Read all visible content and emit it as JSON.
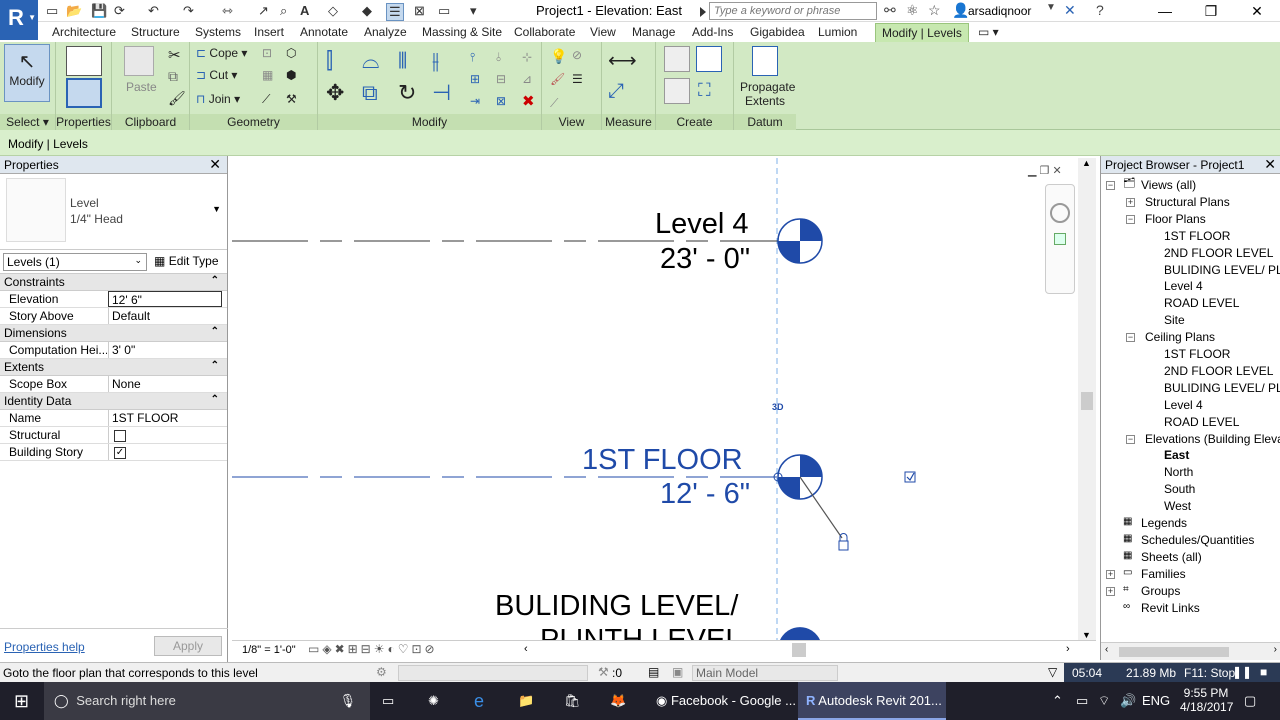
{
  "app": {
    "title": "Project1 - Elevation: East",
    "search_placeholder": "Type a keyword or phrase",
    "user": "arsadiqnoor"
  },
  "tabs": [
    "Architecture",
    "Structure",
    "Systems",
    "Insert",
    "Annotate",
    "Analyze",
    "Massing & Site",
    "Collaborate",
    "View",
    "Manage",
    "Add-Ins",
    "Gigabidea",
    "Lumion",
    "Modify | Levels"
  ],
  "ribbon": {
    "select": {
      "label": "Select",
      "modify": "Modify"
    },
    "properties_label": "Properties",
    "clipboard": {
      "label": "Clipboard",
      "paste": "Paste"
    },
    "geometry": {
      "label": "Geometry",
      "cope": "Cope",
      "cut": "Cut",
      "join": "Join"
    },
    "modify_label": "Modify",
    "view_label": "View",
    "measure_label": "Measure",
    "create_label": "Create",
    "datum": {
      "label": "Datum",
      "propagate": "Propagate",
      "extents": "Extents"
    }
  },
  "context_bar": "Modify | Levels",
  "properties": {
    "title": "Properties",
    "type_name": "Level",
    "type_sub": "1/4\" Head",
    "selector": "Levels (1)",
    "edit_type": "Edit Type",
    "sections": [
      {
        "name": "Constraints",
        "rows": [
          {
            "k": "Elevation",
            "v": "12'  6\""
          },
          {
            "k": "Story Above",
            "v": "Default"
          }
        ]
      },
      {
        "name": "Dimensions",
        "rows": [
          {
            "k": "Computation Hei...",
            "v": "3'  0\""
          }
        ]
      },
      {
        "name": "Extents",
        "rows": [
          {
            "k": "Scope Box",
            "v": "None"
          }
        ]
      },
      {
        "name": "Identity Data",
        "rows": [
          {
            "k": "Name",
            "v": "1ST FLOOR"
          },
          {
            "k": "Structural",
            "v": ""
          },
          {
            "k": "Building Story",
            "v": "✓"
          }
        ]
      }
    ],
    "help": "Properties help",
    "apply": "Apply"
  },
  "canvas": {
    "level4_name": "Level 4",
    "level4_elev": "23' - 0\"",
    "first_name": "1ST FLOOR",
    "first_elev": "12' - 6\"",
    "building_name": "BULIDING LEVEL/",
    "building_name2": "PLINTH LEVEL",
    "marker_3d": "3D",
    "scale": "1/8\" = 1'-0\""
  },
  "browser": {
    "title": "Project Browser - Project1",
    "nodes": [
      "Views (all)",
      "Structural Plans",
      "Floor Plans",
      "1ST FLOOR",
      "2ND FLOOR LEVEL",
      "BULIDING LEVEL/ PLINTH",
      "Level 4",
      "ROAD LEVEL",
      "Site",
      "Ceiling Plans",
      "1ST FLOOR",
      "2ND FLOOR LEVEL",
      "BULIDING LEVEL/ PLINTH",
      "Level 4",
      "ROAD LEVEL",
      "Elevations (Building Elevation)",
      "East",
      "North",
      "South",
      "West",
      "Legends",
      "Schedules/Quantities",
      "Sheets (all)",
      "Families",
      "Groups",
      "Revit Links"
    ]
  },
  "status": {
    "hint": "Goto the floor plan that corresponds to this level",
    "zero": ":0",
    "model": "Main Model",
    "time": "05:04",
    "memory": "21.89 Mb",
    "f11": "F11: Stop"
  },
  "taskbar": {
    "search": "Search right here",
    "chrome": "Facebook - Google ...",
    "revit": "Autodesk Revit 201...",
    "lang": "ENG",
    "clock": "9:55 PM",
    "date": "4/18/2017"
  }
}
